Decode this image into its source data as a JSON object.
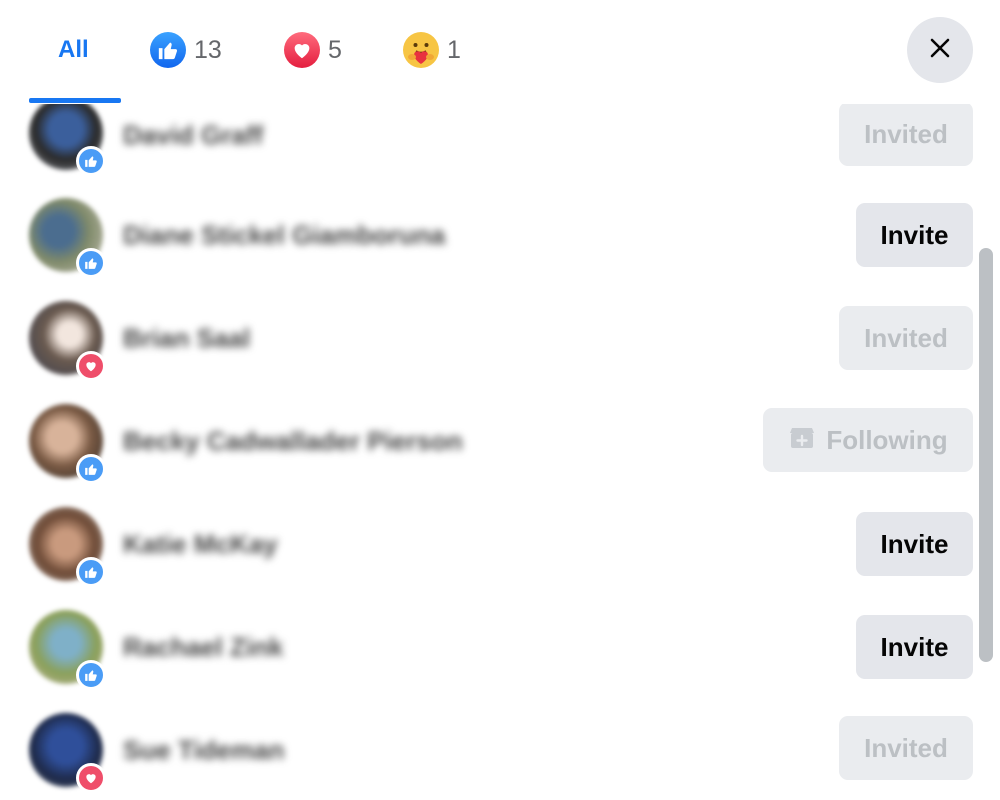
{
  "tabs": {
    "all_label": "All",
    "like_count": "13",
    "love_count": "5",
    "care_count": "1",
    "like_icon": "thumbs-up-icon",
    "love_icon": "heart-icon",
    "care_icon": "care-hug-icon",
    "active_color": "#1877f2"
  },
  "close_icon": "close-icon",
  "people": [
    {
      "name": "David Graff",
      "reaction": "like",
      "action": "Invited"
    },
    {
      "name": "Diane Stickel Giamboruna",
      "reaction": "like",
      "action": "Invite"
    },
    {
      "name": "Brian Saal",
      "reaction": "love",
      "action": "Invited"
    },
    {
      "name": "Becky Cadwallader Pierson",
      "reaction": "like",
      "action": "Following"
    },
    {
      "name": "Katie McKay",
      "reaction": "like",
      "action": "Invite"
    },
    {
      "name": "Rachael Zink",
      "reaction": "like",
      "action": "Invite"
    },
    {
      "name": "Sue Tideman",
      "reaction": "love",
      "action": "Invited"
    }
  ]
}
